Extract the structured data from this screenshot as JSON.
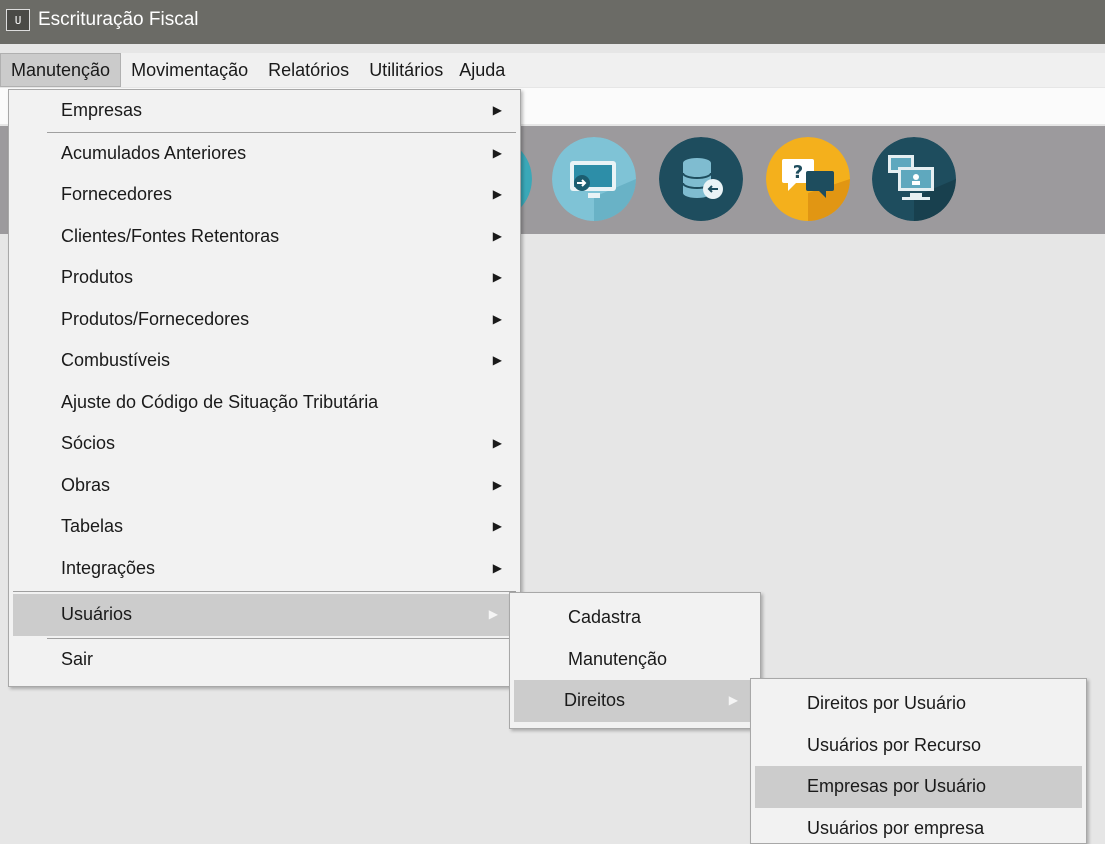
{
  "window": {
    "icon_text": "U",
    "title": "Escrituração Fiscal"
  },
  "menubar": {
    "items": [
      "Manutenção",
      "Movimentação",
      "Relatórios",
      "Utilitários",
      "Ajuda"
    ],
    "active": "Manutenção"
  },
  "toolbar": {
    "icons": [
      "partial-circle-icon",
      "monitor-arrow-icon",
      "database-arrow-icon",
      "help-chat-icon",
      "network-computers-icon"
    ]
  },
  "menu_manutencao": {
    "items": [
      {
        "label": "Empresas",
        "submenu": true
      },
      {
        "label": "Acumulados Anteriores",
        "submenu": true
      },
      {
        "label": "Fornecedores",
        "submenu": true
      },
      {
        "label": "Clientes/Fontes Retentoras",
        "submenu": true
      },
      {
        "label": "Produtos",
        "submenu": true
      },
      {
        "label": "Produtos/Fornecedores",
        "submenu": true
      },
      {
        "label": "Combustíveis",
        "submenu": true
      },
      {
        "label": "Ajuste do Código de Situação Tributária",
        "submenu": false
      },
      {
        "label": "Sócios",
        "submenu": true
      },
      {
        "label": "Obras",
        "submenu": true
      },
      {
        "label": "Tabelas",
        "submenu": true
      },
      {
        "label": "Integrações",
        "submenu": true
      },
      {
        "label": "Usuários",
        "submenu": true,
        "highlighted": true
      },
      {
        "label": "Sair",
        "submenu": false
      }
    ]
  },
  "menu_usuarios": {
    "items": [
      {
        "label": "Cadastra"
      },
      {
        "label": "Manutenção"
      },
      {
        "label": "Direitos",
        "submenu": true,
        "highlighted": true
      }
    ]
  },
  "menu_direitos": {
    "items": [
      {
        "label": "Direitos por Usuário"
      },
      {
        "label": "Usuários por Recurso"
      },
      {
        "label": "Empresas por Usuário",
        "highlighted": true
      },
      {
        "label": "Usuários por empresa"
      }
    ]
  }
}
